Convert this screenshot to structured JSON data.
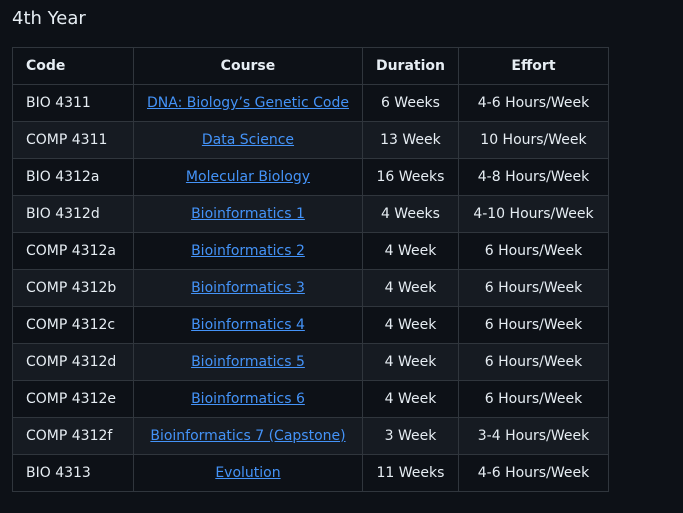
{
  "heading": "4th Year",
  "columns": [
    "Code",
    "Course",
    "Duration",
    "Effort"
  ],
  "rows": [
    {
      "code": "BIO 4311",
      "course": "DNA: Biology’s Genetic Code",
      "duration": "6 Weeks",
      "effort": "4-6 Hours/Week"
    },
    {
      "code": "COMP 4311",
      "course": "Data Science",
      "duration": "13 Week",
      "effort": "10 Hours/Week"
    },
    {
      "code": "BIO 4312a",
      "course": "Molecular Biology",
      "duration": "16 Weeks",
      "effort": "4-8 Hours/Week"
    },
    {
      "code": "BIO 4312d",
      "course": "Bioinformatics 1",
      "duration": "4 Weeks",
      "effort": "4-10 Hours/Week"
    },
    {
      "code": "COMP 4312a",
      "course": "Bioinformatics 2",
      "duration": "4 Week",
      "effort": "6 Hours/Week"
    },
    {
      "code": "COMP 4312b",
      "course": "Bioinformatics 3",
      "duration": "4 Week",
      "effort": "6 Hours/Week"
    },
    {
      "code": "COMP 4312c",
      "course": "Bioinformatics 4",
      "duration": "4 Week",
      "effort": "6 Hours/Week"
    },
    {
      "code": "COMP 4312d",
      "course": "Bioinformatics 5",
      "duration": "4 Week",
      "effort": "6 Hours/Week"
    },
    {
      "code": "COMP 4312e",
      "course": "Bioinformatics 6",
      "duration": "4 Week",
      "effort": "6 Hours/Week"
    },
    {
      "code": "COMP 4312f",
      "course": "Bioinformatics 7 (Capstone)",
      "duration": "3 Week",
      "effort": "3-4 Hours/Week"
    },
    {
      "code": "BIO 4313",
      "course": "Evolution",
      "duration": "11 Weeks",
      "effort": "4-6 Hours/Week"
    }
  ],
  "colors": {
    "background": "#0d1117",
    "alt_row": "#161b22",
    "border": "#30363d",
    "link": "#4493f8",
    "text": "#e6edf3"
  }
}
